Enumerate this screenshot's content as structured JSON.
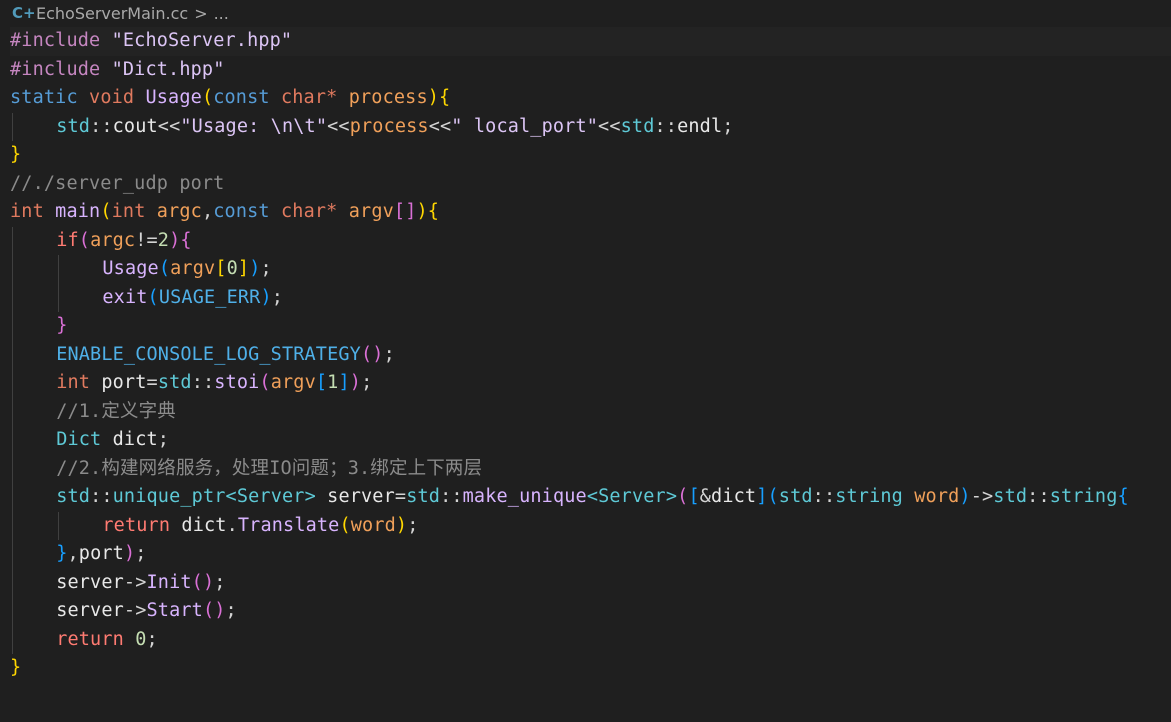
{
  "breadcrumb": {
    "file_icon": "cpp-file-icon",
    "file_icon_glyph": "C+",
    "file_name": "EchoServerMain.cc",
    "separator": ">",
    "ellipsis": "..."
  },
  "colors": {
    "background": "#1f1f1f",
    "keyword": "#569cd6",
    "string": "#dcc5f5",
    "function": "#d8b4fe",
    "comment": "#8b8b8b",
    "bracket_level_1": "#ffd700",
    "bracket_level_2": "#da70d6",
    "bracket_level_3": "#179fff"
  },
  "code": {
    "lines": [
      {
        "indent": 0,
        "tokens": [
          {
            "t": "#include",
            "c": "pal-inc"
          },
          {
            "t": " ",
            "c": "pal-pl"
          },
          {
            "t": "\"EchoServer.hpp\"",
            "c": "pal-str"
          }
        ]
      },
      {
        "indent": 0,
        "tokens": [
          {
            "t": "#include",
            "c": "pal-inc"
          },
          {
            "t": " ",
            "c": "pal-pl"
          },
          {
            "t": "\"Dict.hpp\"",
            "c": "pal-str"
          }
        ]
      },
      {
        "indent": 0,
        "tokens": [
          {
            "t": "static",
            "c": "pal-kw"
          },
          {
            "t": " ",
            "c": "pal-pl"
          },
          {
            "t": "void",
            "c": "pal-ty2"
          },
          {
            "t": " ",
            "c": "pal-pl"
          },
          {
            "t": "Usage",
            "c": "pal-fn"
          },
          {
            "t": "(",
            "c": "pal-br1"
          },
          {
            "t": "const",
            "c": "pal-kw"
          },
          {
            "t": " ",
            "c": "pal-pl"
          },
          {
            "t": "char",
            "c": "pal-ty2"
          },
          {
            "t": "*",
            "c": "pal-ty2"
          },
          {
            "t": " ",
            "c": "pal-pl"
          },
          {
            "t": "process",
            "c": "pal-par"
          },
          {
            "t": ")",
            "c": "pal-br1"
          },
          {
            "t": "{",
            "c": "pal-br1"
          }
        ]
      },
      {
        "indent": 1,
        "tokens": [
          {
            "t": "std",
            "c": "pal-std"
          },
          {
            "t": "::",
            "c": "pal-op"
          },
          {
            "t": "cout",
            "c": "pal-var"
          },
          {
            "t": "<<",
            "c": "pal-op"
          },
          {
            "t": "\"Usage: \\n\\t\"",
            "c": "pal-str"
          },
          {
            "t": "<<",
            "c": "pal-op"
          },
          {
            "t": "process",
            "c": "pal-par"
          },
          {
            "t": "<<",
            "c": "pal-op"
          },
          {
            "t": "\" local_port\"",
            "c": "pal-str"
          },
          {
            "t": "<<",
            "c": "pal-op"
          },
          {
            "t": "std",
            "c": "pal-std"
          },
          {
            "t": "::",
            "c": "pal-op"
          },
          {
            "t": "endl",
            "c": "pal-var"
          },
          {
            "t": ";",
            "c": "pal-pl"
          }
        ]
      },
      {
        "indent": 0,
        "tokens": [
          {
            "t": "}",
            "c": "pal-br1"
          }
        ]
      },
      {
        "indent": 0,
        "tokens": [
          {
            "t": "//./server_udp port",
            "c": "pal-cm"
          }
        ]
      },
      {
        "indent": 0,
        "tokens": [
          {
            "t": "int",
            "c": "pal-ty2"
          },
          {
            "t": " ",
            "c": "pal-pl"
          },
          {
            "t": "main",
            "c": "pal-fn"
          },
          {
            "t": "(",
            "c": "pal-br1"
          },
          {
            "t": "int",
            "c": "pal-ty2"
          },
          {
            "t": " ",
            "c": "pal-pl"
          },
          {
            "t": "argc",
            "c": "pal-par"
          },
          {
            "t": ",",
            "c": "pal-pl"
          },
          {
            "t": "const",
            "c": "pal-kw"
          },
          {
            "t": " ",
            "c": "pal-pl"
          },
          {
            "t": "char",
            "c": "pal-ty2"
          },
          {
            "t": "*",
            "c": "pal-ty2"
          },
          {
            "t": " ",
            "c": "pal-pl"
          },
          {
            "t": "argv",
            "c": "pal-par"
          },
          {
            "t": "[",
            "c": "pal-br2"
          },
          {
            "t": "]",
            "c": "pal-br2"
          },
          {
            "t": ")",
            "c": "pal-br1"
          },
          {
            "t": "{",
            "c": "pal-br1"
          }
        ]
      },
      {
        "indent": 1,
        "tokens": [
          {
            "t": "if",
            "c": "pal-ret"
          },
          {
            "t": "(",
            "c": "pal-br2"
          },
          {
            "t": "argc",
            "c": "pal-par"
          },
          {
            "t": "!=",
            "c": "pal-op"
          },
          {
            "t": "2",
            "c": "pal-num"
          },
          {
            "t": ")",
            "c": "pal-br2"
          },
          {
            "t": "{",
            "c": "pal-br2"
          }
        ]
      },
      {
        "indent": 2,
        "tokens": [
          {
            "t": "Usage",
            "c": "pal-fn"
          },
          {
            "t": "(",
            "c": "pal-br3"
          },
          {
            "t": "argv",
            "c": "pal-par"
          },
          {
            "t": "[",
            "c": "pal-br1"
          },
          {
            "t": "0",
            "c": "pal-num"
          },
          {
            "t": "]",
            "c": "pal-br1"
          },
          {
            "t": ")",
            "c": "pal-br3"
          },
          {
            "t": ";",
            "c": "pal-pl"
          }
        ]
      },
      {
        "indent": 2,
        "tokens": [
          {
            "t": "exit",
            "c": "pal-fn"
          },
          {
            "t": "(",
            "c": "pal-br3"
          },
          {
            "t": "USAGE_ERR",
            "c": "pal-mac"
          },
          {
            "t": ")",
            "c": "pal-br3"
          },
          {
            "t": ";",
            "c": "pal-pl"
          }
        ]
      },
      {
        "indent": 1,
        "tokens": [
          {
            "t": "}",
            "c": "pal-br2"
          }
        ]
      },
      {
        "indent": 1,
        "tokens": [
          {
            "t": "ENABLE_CONSOLE_LOG_STRATEGY",
            "c": "pal-mac"
          },
          {
            "t": "(",
            "c": "pal-br2"
          },
          {
            "t": ")",
            "c": "pal-br2"
          },
          {
            "t": ";",
            "c": "pal-pl"
          }
        ]
      },
      {
        "indent": 1,
        "tokens": [
          {
            "t": "int",
            "c": "pal-ty2"
          },
          {
            "t": " ",
            "c": "pal-pl"
          },
          {
            "t": "port",
            "c": "pal-var"
          },
          {
            "t": "=",
            "c": "pal-op"
          },
          {
            "t": "std",
            "c": "pal-std"
          },
          {
            "t": "::",
            "c": "pal-op"
          },
          {
            "t": "stoi",
            "c": "pal-fn"
          },
          {
            "t": "(",
            "c": "pal-br2"
          },
          {
            "t": "argv",
            "c": "pal-par"
          },
          {
            "t": "[",
            "c": "pal-br3"
          },
          {
            "t": "1",
            "c": "pal-num"
          },
          {
            "t": "]",
            "c": "pal-br3"
          },
          {
            "t": ")",
            "c": "pal-br2"
          },
          {
            "t": ";",
            "c": "pal-pl"
          }
        ]
      },
      {
        "indent": 1,
        "tokens": [
          {
            "t": "//1.定义字典",
            "c": "pal-cm"
          }
        ]
      },
      {
        "indent": 1,
        "tokens": [
          {
            "t": "Dict",
            "c": "pal-ty"
          },
          {
            "t": " ",
            "c": "pal-pl"
          },
          {
            "t": "dict",
            "c": "pal-var"
          },
          {
            "t": ";",
            "c": "pal-pl"
          }
        ]
      },
      {
        "indent": 1,
        "tokens": [
          {
            "t": "//2.构建网络服务，处理IO问题；3.绑定上下两层",
            "c": "pal-cm"
          }
        ]
      },
      {
        "indent": 1,
        "tokens": [
          {
            "t": "std",
            "c": "pal-std"
          },
          {
            "t": "::",
            "c": "pal-op"
          },
          {
            "t": "unique_ptr",
            "c": "pal-own"
          },
          {
            "t": "<",
            "c": "pal-own"
          },
          {
            "t": "Server",
            "c": "pal-ty"
          },
          {
            "t": ">",
            "c": "pal-own"
          },
          {
            "t": " ",
            "c": "pal-pl"
          },
          {
            "t": "server",
            "c": "pal-var"
          },
          {
            "t": "=",
            "c": "pal-op"
          },
          {
            "t": "std",
            "c": "pal-std"
          },
          {
            "t": "::",
            "c": "pal-op"
          },
          {
            "t": "make_unique",
            "c": "pal-fn"
          },
          {
            "t": "<",
            "c": "pal-own"
          },
          {
            "t": "Server",
            "c": "pal-ty"
          },
          {
            "t": ">",
            "c": "pal-own"
          },
          {
            "t": "(",
            "c": "pal-br2"
          },
          {
            "t": "[",
            "c": "pal-br3"
          },
          {
            "t": "&",
            "c": "pal-op"
          },
          {
            "t": "dict",
            "c": "pal-var"
          },
          {
            "t": "]",
            "c": "pal-br3"
          },
          {
            "t": "(",
            "c": "pal-br3"
          },
          {
            "t": "std",
            "c": "pal-std"
          },
          {
            "t": "::",
            "c": "pal-op"
          },
          {
            "t": "string",
            "c": "pal-ty"
          },
          {
            "t": " ",
            "c": "pal-pl"
          },
          {
            "t": "word",
            "c": "pal-par"
          },
          {
            "t": ")",
            "c": "pal-br3"
          },
          {
            "t": "->",
            "c": "pal-op"
          },
          {
            "t": "std",
            "c": "pal-std"
          },
          {
            "t": "::",
            "c": "pal-op"
          },
          {
            "t": "string",
            "c": "pal-ty"
          },
          {
            "t": "{",
            "c": "pal-br3"
          }
        ]
      },
      {
        "indent": 2,
        "tokens": [
          {
            "t": "return",
            "c": "pal-ret"
          },
          {
            "t": " ",
            "c": "pal-pl"
          },
          {
            "t": "dict",
            "c": "pal-var"
          },
          {
            "t": ".",
            "c": "pal-op"
          },
          {
            "t": "Translate",
            "c": "pal-fn"
          },
          {
            "t": "(",
            "c": "pal-br1"
          },
          {
            "t": "word",
            "c": "pal-par"
          },
          {
            "t": ")",
            "c": "pal-br1"
          },
          {
            "t": ";",
            "c": "pal-pl"
          }
        ]
      },
      {
        "indent": 1,
        "tokens": [
          {
            "t": "}",
            "c": "pal-br3"
          },
          {
            "t": ",",
            "c": "pal-pl"
          },
          {
            "t": "port",
            "c": "pal-var"
          },
          {
            "t": ")",
            "c": "pal-br2"
          },
          {
            "t": ";",
            "c": "pal-pl"
          }
        ]
      },
      {
        "indent": 1,
        "tokens": [
          {
            "t": "server",
            "c": "pal-var"
          },
          {
            "t": "->",
            "c": "pal-op"
          },
          {
            "t": "Init",
            "c": "pal-fn"
          },
          {
            "t": "(",
            "c": "pal-br2"
          },
          {
            "t": ")",
            "c": "pal-br2"
          },
          {
            "t": ";",
            "c": "pal-pl"
          }
        ]
      },
      {
        "indent": 1,
        "tokens": [
          {
            "t": "server",
            "c": "pal-var"
          },
          {
            "t": "->",
            "c": "pal-op"
          },
          {
            "t": "Start",
            "c": "pal-fn"
          },
          {
            "t": "(",
            "c": "pal-br2"
          },
          {
            "t": ")",
            "c": "pal-br2"
          },
          {
            "t": ";",
            "c": "pal-pl"
          }
        ]
      },
      {
        "indent": 1,
        "tokens": [
          {
            "t": "return",
            "c": "pal-ret"
          },
          {
            "t": " ",
            "c": "pal-pl"
          },
          {
            "t": "0",
            "c": "pal-num"
          },
          {
            "t": ";",
            "c": "pal-pl"
          }
        ]
      },
      {
        "indent": 0,
        "tokens": [
          {
            "t": "}",
            "c": "pal-br1"
          }
        ]
      }
    ]
  }
}
